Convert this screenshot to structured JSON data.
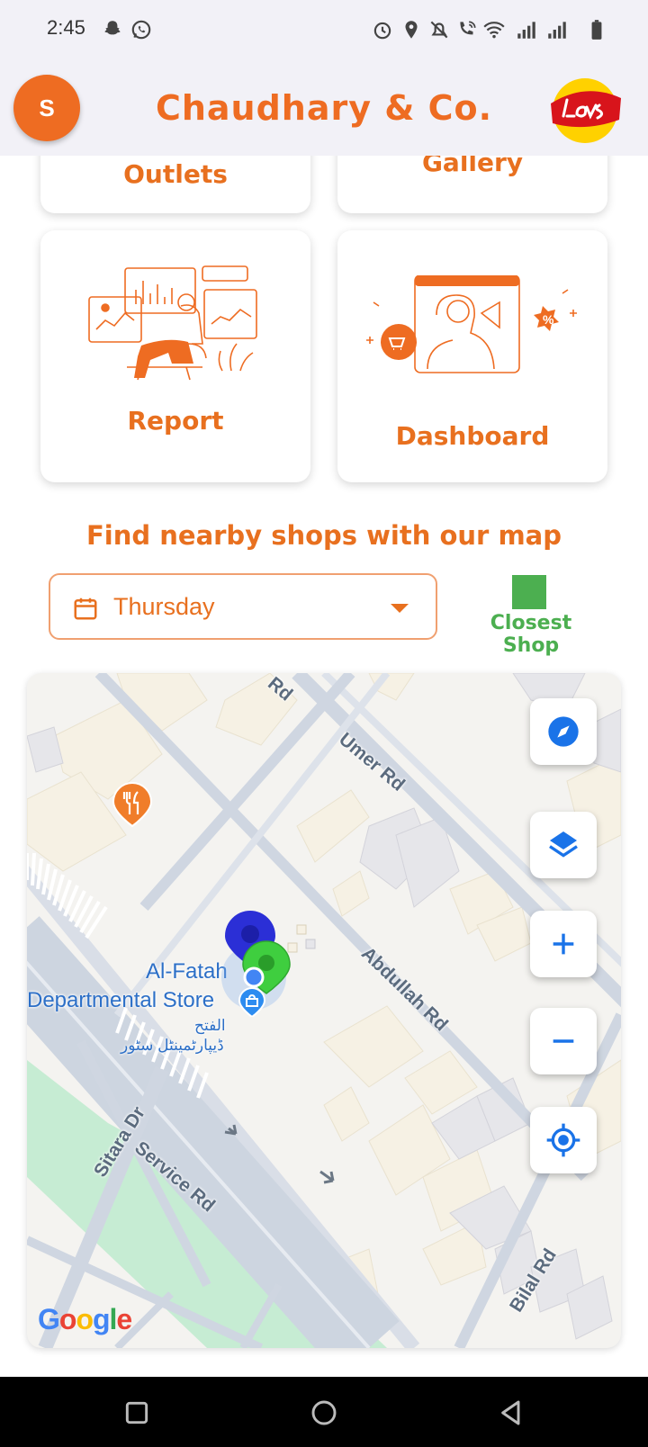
{
  "status_bar": {
    "time": "2:45",
    "left_icons": [
      "snapchat-icon",
      "whatsapp-icon"
    ],
    "right_icons": [
      "alarm-icon",
      "location-icon",
      "mute-icon",
      "wifi-call-icon",
      "wifi-icon",
      "signal-icon",
      "signal-icon",
      "battery-icon"
    ]
  },
  "header": {
    "avatar_initial": "S",
    "title": "Chaudhary & Co.",
    "brand_logo_text": "Lay's"
  },
  "cards": {
    "outlets": "Outlets",
    "gallery": "Gallery",
    "report": "Report",
    "dashboard": "Dashboard"
  },
  "map_section": {
    "title": "Find nearby shops with our map",
    "day_value": "Thursday",
    "legend_label": "Closest Shop"
  },
  "map": {
    "road_labels": [
      "Rd",
      "Umer Rd",
      "Abdullah Rd",
      "Sitara Dr",
      "Service Rd",
      "Bilal Rd"
    ],
    "poi": {
      "name_line1": "Al-Fatah",
      "name_line2": "Departmental Store",
      "urdu_line1": "الفتح",
      "urdu_line2": "ڈیپارٹمینٹل سٹور"
    },
    "attribution": "Google",
    "buttons": [
      "compass-icon",
      "layers-icon",
      "zoom-in-icon",
      "zoom-out-icon",
      "my-location-icon"
    ]
  },
  "colors": {
    "accent": "#ee6c22",
    "closest_shop": "#4caf50",
    "marker_blue": "#2b2fd6",
    "map_button_icon": "#1a73e8"
  },
  "nav_bar": [
    "recents-icon",
    "home-icon",
    "back-icon"
  ]
}
